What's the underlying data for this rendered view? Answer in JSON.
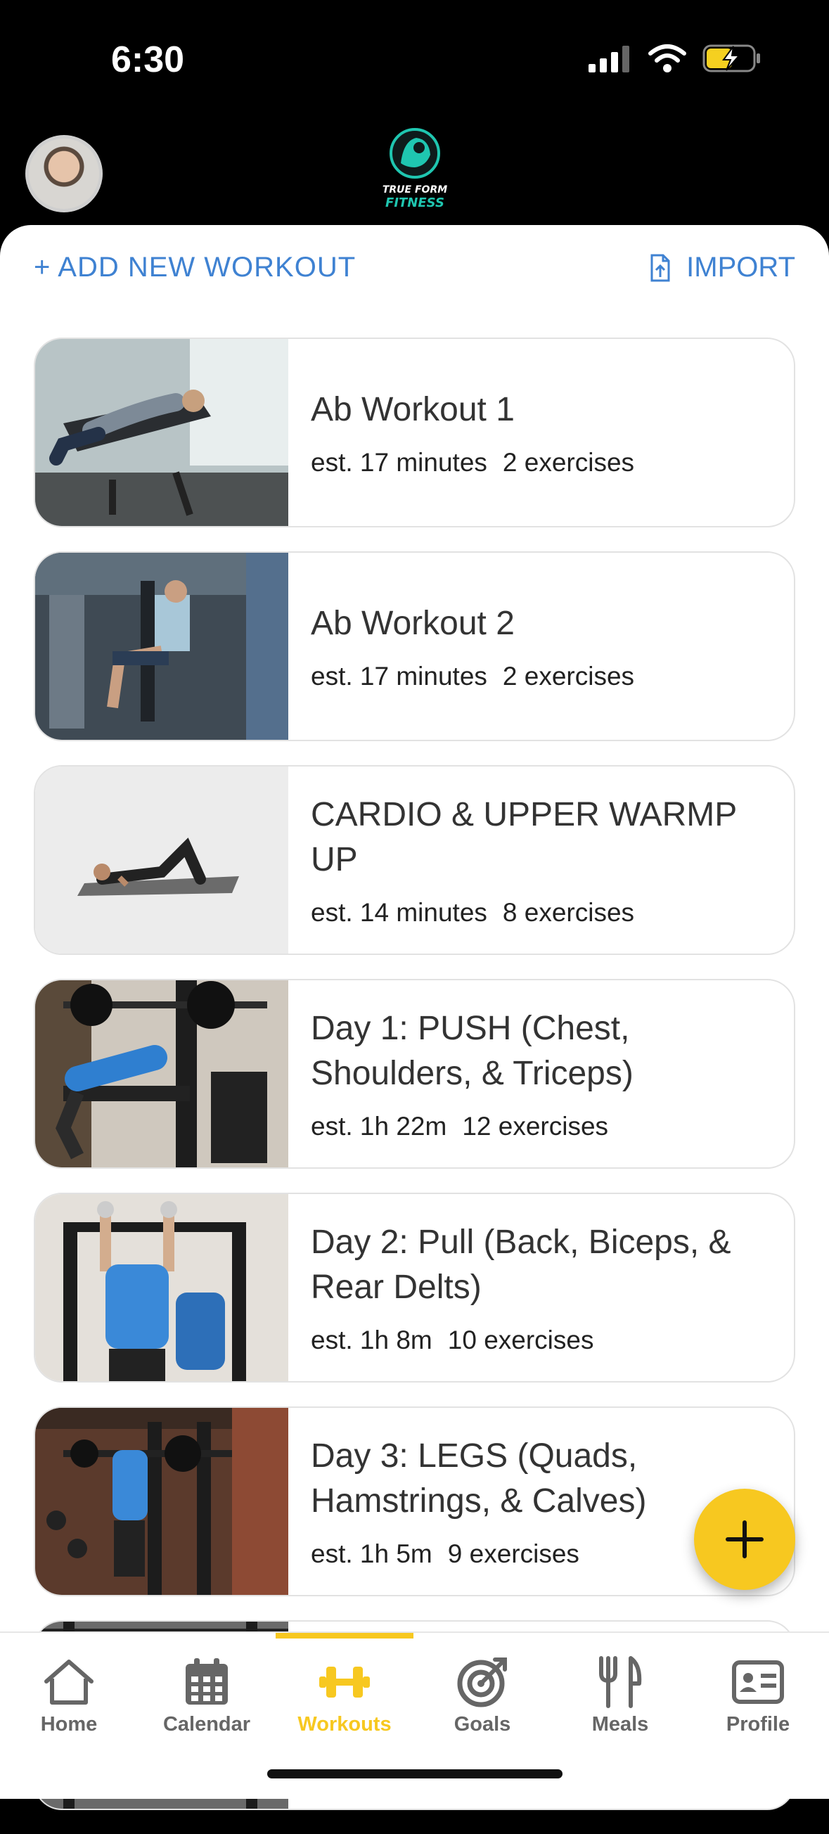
{
  "status": {
    "time": "6:30"
  },
  "header": {
    "logo_line1": "TRUE FORM",
    "logo_line2": "FITNESS"
  },
  "actions": {
    "add_label": "+ ADD NEW WORKOUT",
    "import_label": "IMPORT"
  },
  "workouts": [
    {
      "title": "Ab Workout 1",
      "duration": "est. 17 minutes",
      "exercises": "2 exercises"
    },
    {
      "title": "Ab Workout 2",
      "duration": "est. 17 minutes",
      "exercises": "2 exercises"
    },
    {
      "title": "CARDIO & UPPER WARMP UP",
      "duration": "est. 14 minutes",
      "exercises": "8 exercises"
    },
    {
      "title": "Day 1: PUSH (Chest, Shoulders, & Triceps)",
      "duration": "est. 1h 22m",
      "exercises": "12 exercises"
    },
    {
      "title": "Day 2: Pull (Back, Biceps, & Rear Delts)",
      "duration": "est. 1h 8m",
      "exercises": "10 exercises"
    },
    {
      "title": "Day 3: LEGS (Quads, Hamstrings, & Calves)",
      "duration": "est. 1h 5m",
      "exercises": "9 exercises"
    }
  ],
  "tabs": [
    {
      "label": "Home",
      "icon": "home-icon"
    },
    {
      "label": "Calendar",
      "icon": "calendar-icon"
    },
    {
      "label": "Workouts",
      "icon": "dumbbell-icon",
      "active": true
    },
    {
      "label": "Goals",
      "icon": "target-icon"
    },
    {
      "label": "Meals",
      "icon": "utensils-icon"
    },
    {
      "label": "Profile",
      "icon": "profile-card-icon"
    }
  ],
  "colors": {
    "accent": "#f7c820",
    "link": "#3f82d2",
    "logo_teal": "#1fc6b0"
  }
}
